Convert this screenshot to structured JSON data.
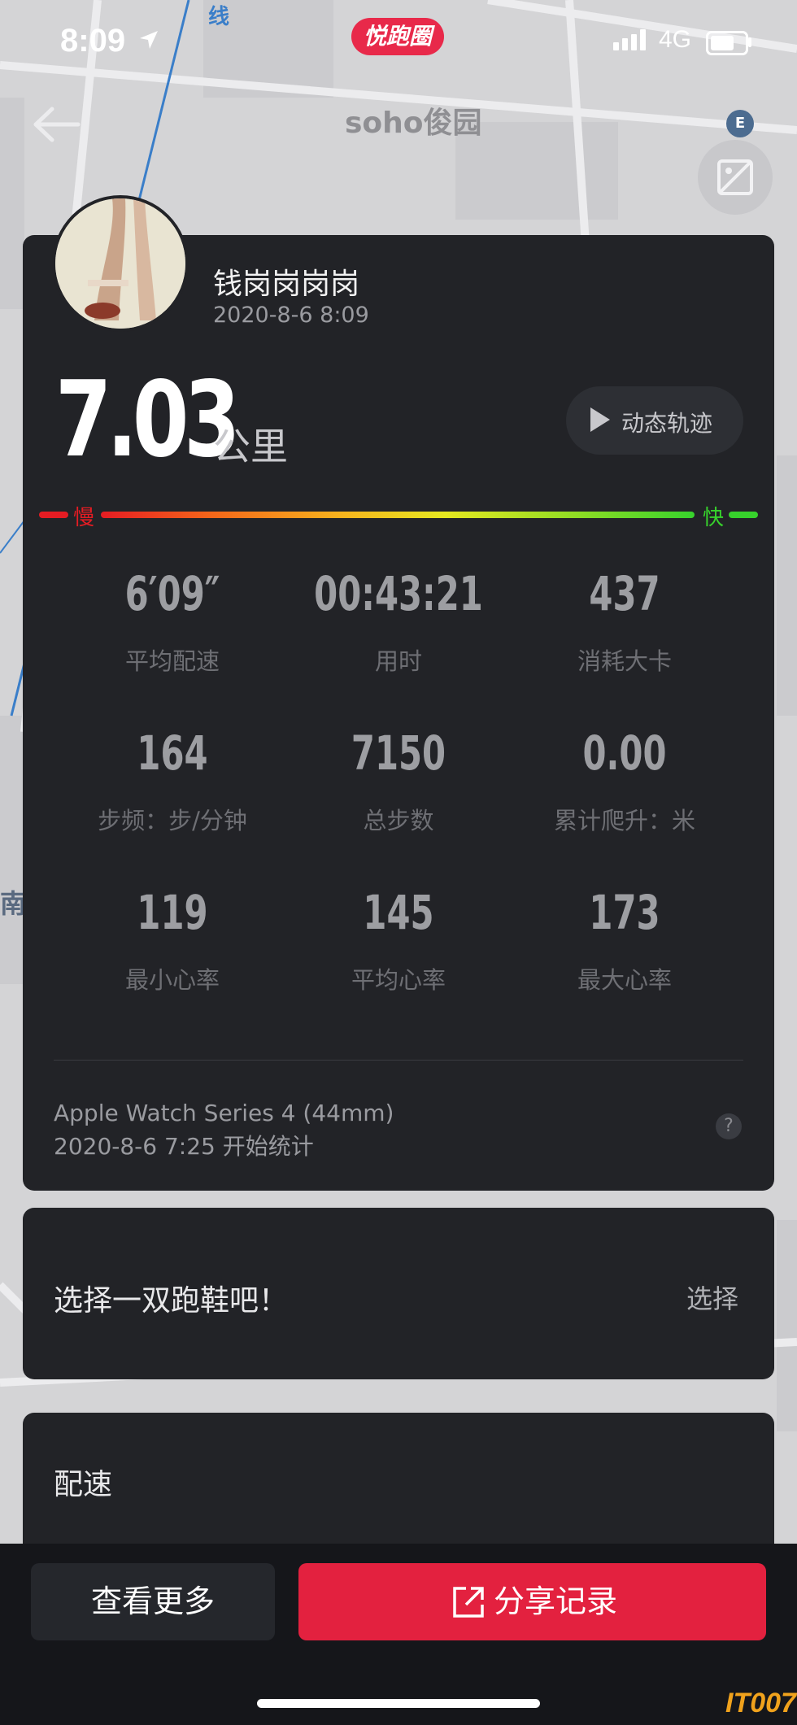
{
  "status_bar": {
    "time": "8:09",
    "network": "4G"
  },
  "app": {
    "logo_text": "悦跑圈"
  },
  "map": {
    "labels": [
      "soho俊园",
      "南",
      "线"
    ]
  },
  "user": {
    "name": "钱岗岗岗岗",
    "date": "2020-8-6 8:09"
  },
  "distance": {
    "value": "7.03",
    "unit": "公里"
  },
  "track_button": {
    "label": "动态轨迹"
  },
  "pace_scale": {
    "slow": "慢",
    "fast": "快"
  },
  "stats": [
    {
      "value": "6′09″",
      "label": "平均配速"
    },
    {
      "value": "00:43:21",
      "label": "用时"
    },
    {
      "value": "437",
      "label": "消耗大卡"
    },
    {
      "value": "164",
      "label": "步频：步/分钟"
    },
    {
      "value": "7150",
      "label": "总步数"
    },
    {
      "value": "0.00",
      "label": "累计爬升：米"
    },
    {
      "value": "119",
      "label": "最小心率"
    },
    {
      "value": "145",
      "label": "平均心率"
    },
    {
      "value": "173",
      "label": "最大心率"
    }
  ],
  "device": {
    "name": "Apple Watch Series 4 (44mm)",
    "start": "2020-8-6 7:25 开始统计",
    "help": "?"
  },
  "shoe": {
    "prompt": "选择一双跑鞋吧！",
    "action": "选择"
  },
  "pace_section": {
    "title": "配速"
  },
  "bottom": {
    "more_label": "查看更多",
    "share_label": "分享记录"
  },
  "watermark": "IT007",
  "colors": {
    "accent": "#e3213f",
    "card": "#222327",
    "slow": "#e51c23",
    "fast": "#37d22c"
  }
}
